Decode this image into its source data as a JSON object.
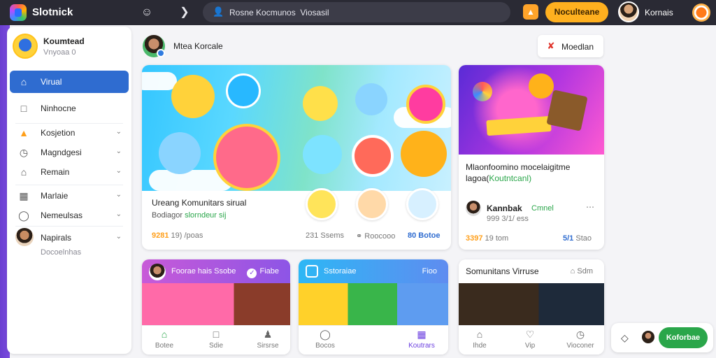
{
  "topbar": {
    "app_title": "Slotnick",
    "search_placeholder": "Rosne Kocmunos  Viosasil",
    "cta_label": "Noculteane",
    "user_name": "Kornais",
    "icons": [
      "logo-icon",
      "user-icon",
      "play-icon",
      "search-icon",
      "orange-chip-icon",
      "notification-icon"
    ]
  },
  "sidebar": {
    "profile": {
      "name": "Koumtead",
      "sub": "Vnyoaa 0"
    },
    "items": [
      {
        "label": "Virual",
        "icon": "home-icon",
        "active": true
      },
      {
        "label": "Ninhocne",
        "icon": "bag-icon"
      },
      {
        "label": "Kosjetion",
        "icon": "fire-icon"
      },
      {
        "label": "Magndgesi",
        "icon": "clock-icon"
      },
      {
        "label": "Remain",
        "icon": "home-outline-icon"
      },
      {
        "label": "Marlaie",
        "icon": "grid-icon"
      },
      {
        "label": "Nemeulsas",
        "icon": "shield-icon"
      },
      {
        "label": "Napirals",
        "icon": "avatar-icon"
      }
    ],
    "footer_text": "Docoelnhas"
  },
  "main": {
    "group_name": "Mtea Korcale",
    "top_right_button": "Moedlan",
    "hero": {
      "title": "Ureang Komunitars sirual",
      "sub_prefix": "Bodiagor",
      "sub_highlight": "slorndeur sij",
      "stat_left_num": "9281",
      "stat_left_text": "19) /poas",
      "stat_mid": "231 Ssems",
      "stat_mid2": "Roocooo",
      "stat_right": "80 Botoe"
    },
    "feature": {
      "title_line1": "Mlaonfoomino mocelaigitme",
      "title_line2_prefix": "lagoa(",
      "title_line2_highlight": "Koutntcanl)",
      "author": "Kannbak",
      "author_tag": "Cmnel",
      "meta": "999 3/1/ ess",
      "foot_num": "3397",
      "foot_text": "19 tom",
      "foot_right_num": "5/1",
      "foot_right": "Stao"
    },
    "bottom_cards": [
      {
        "title": "Foorae hais Ssobe",
        "pill": "Fiabe",
        "tabs": [
          {
            "label": "Botee",
            "icon": "home-icon"
          },
          {
            "label": "Sdie",
            "icon": "square-icon"
          },
          {
            "label": "Sirsrse",
            "icon": "person-icon"
          }
        ]
      },
      {
        "title": "Sstoraiae",
        "pill": "Fioo",
        "tabs": [
          {
            "label": "Bocos",
            "icon": "fire-icon"
          },
          {
            "label": "Koutrars",
            "icon": "calendar-icon"
          }
        ]
      },
      {
        "title": "Somunitans Virruse",
        "pill": "Sdm",
        "tabs": [
          {
            "label": "Ihde",
            "icon": "home-icon"
          },
          {
            "label": "Vip",
            "icon": "heart-icon"
          },
          {
            "label": "Vioconer",
            "icon": "clock-icon"
          }
        ]
      }
    ],
    "float_button": "Koforbae"
  },
  "colors": {
    "accent_blue": "#2f6cd0",
    "accent_orange": "#ffb01f",
    "accent_green": "#2aa64a",
    "topbar": "#2a2a34"
  }
}
